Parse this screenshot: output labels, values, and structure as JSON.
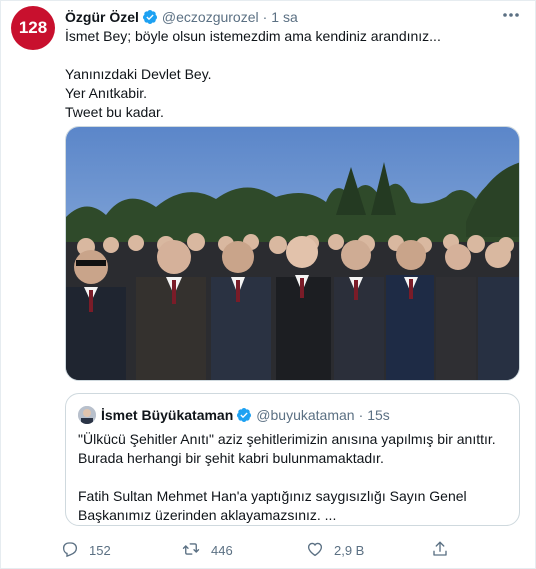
{
  "author": {
    "avatar_text": "128",
    "name": "Özgür Özel",
    "handle": "@eczozgurozel",
    "separator": "·",
    "time": "1 sa"
  },
  "tweet_text": {
    "line1": "İsmet Bey; böyle olsun istemezdim ama kendiniz arandınız...",
    "line2": "Yanınızdaki Devlet Bey.",
    "line3": "Yer Anıtkabir.",
    "line4": "Tweet bu kadar."
  },
  "quoted_tweet": {
    "name": "İsmet Büyükataman",
    "handle": "@buyukataman",
    "separator": "·",
    "time": "15s",
    "line1": "\"Ülkücü Şehitler Anıtı\" aziz şehitlerimizin anısına yapılmış bir anıttır.",
    "line2": "Burada herhangi bir şehit kabri bulunmamaktadır.",
    "line3": "Fatih Sultan Mehmet Han'a yaptığınız saygısızlığı Sayın Genel",
    "line4": "Başkanımız üzerinden aklayamazsınız. ..."
  },
  "actions": {
    "reply_count": "152",
    "retweet_count": "446",
    "like_count": "2,9 B"
  },
  "icons": {
    "verified": "verified-badge-icon",
    "more": "more-icon",
    "reply": "reply-icon",
    "retweet": "retweet-icon",
    "like": "like-icon",
    "share": "share-icon"
  },
  "colors": {
    "brand_red": "#c8102e",
    "verified_blue": "#1da1f2",
    "secondary_text": "#5b7083",
    "border": "#cfd9de"
  }
}
